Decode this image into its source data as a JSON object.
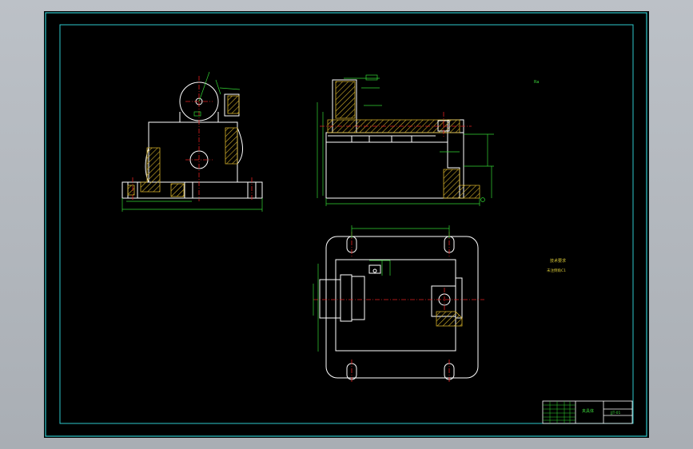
{
  "drawing": {
    "colors": {
      "viewport_bg": "#b0b5bb",
      "sheet_bg": "#000000",
      "frame": "#2ec8cc",
      "geometry": "#ffffff",
      "dimension": "#33d633",
      "centerline": "#e02020",
      "hatch": "#d4b02a"
    },
    "annotations": {
      "top_right_note": "Ra",
      "notes_title": "技术要求",
      "notes_line": "未注倒角C1"
    },
    "title_block": {
      "drawing_name": "夹具体",
      "drawing_code": "JJT-01"
    }
  }
}
